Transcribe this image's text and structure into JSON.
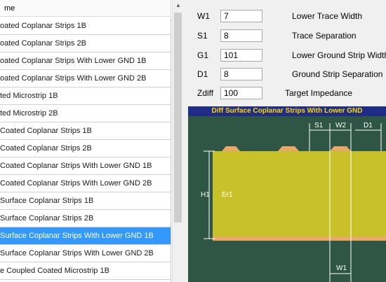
{
  "list": {
    "header": "me",
    "selected_index": 12,
    "items": [
      "oated Coplanar Strips 1B",
      "oated Coplanar Strips 2B",
      "oated Coplanar Strips With Lower GND 1B",
      "oated Coplanar Strips With Lower GND 2B",
      "ted Microstrip 1B",
      "ted Microstrip 2B",
      " Coated Coplanar Strips 1B",
      " Coated Coplanar Strips 2B",
      " Coated Coplanar Strips With Lower GND 1B",
      " Coated Coplanar Strips With Lower GND 2B",
      "Surface Coplanar Strips 1B",
      "Surface Coplanar Strips 2B",
      "Surface Coplanar Strips With Lower GND 1B",
      "Surface Coplanar Strips With Lower GND 2B",
      "e Coupled Coated Microstrip 1B"
    ]
  },
  "params": [
    {
      "name": "W1",
      "value": "7",
      "desc": "Lower Trace Width"
    },
    {
      "name": "S1",
      "value": "8",
      "desc": "Trace Separation"
    },
    {
      "name": "G1",
      "value": "101",
      "desc": "Lower Ground Strip Width"
    },
    {
      "name": "D1",
      "value": "8",
      "desc": "Ground Strip Separation"
    },
    {
      "name": "Zdiff",
      "value": "100",
      "desc": "Target Impedance"
    }
  ],
  "diagram": {
    "title": "Diff Surface Coplanar Strips With Lower GND",
    "labels": {
      "s1": "S1",
      "w2": "W2",
      "d1": "D1",
      "h1": "H1",
      "er1": "Er1",
      "w1": "W1"
    },
    "colors": {
      "background": "#2f5544",
      "dielectric": "#c9c12a",
      "copper": "#e8a868",
      "title_bg": "#1f2d86",
      "title_fg": "#ffd700"
    }
  }
}
